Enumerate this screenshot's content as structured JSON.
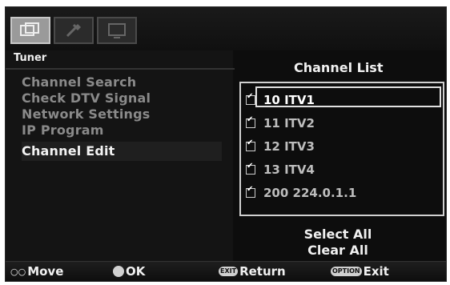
{
  "tabs": [
    {
      "icon": "channel-icon",
      "active": true
    },
    {
      "icon": "tools-icon",
      "active": false
    },
    {
      "icon": "screen-icon",
      "active": false
    }
  ],
  "section_label": "Tuner",
  "menu": {
    "items": [
      {
        "label": "Channel Search"
      },
      {
        "label": "Check DTV Signal"
      },
      {
        "label": "Network Settings"
      },
      {
        "label": "IP Program"
      },
      {
        "label": "Channel Edit"
      }
    ]
  },
  "channel_list": {
    "title": "Channel List",
    "items": [
      {
        "number_name": "10 ITV1",
        "checked": true,
        "selected": true
      },
      {
        "number_name": "11 ITV2",
        "checked": true,
        "selected": false
      },
      {
        "number_name": "12 ITV3",
        "checked": true,
        "selected": false
      },
      {
        "number_name": "13 ITV4",
        "checked": true,
        "selected": false
      },
      {
        "number_name": "200 224.0.1.1",
        "checked": true,
        "selected": false
      }
    ]
  },
  "actions": {
    "select_all": "Select All",
    "clear_all": "Clear All"
  },
  "bottom": {
    "move": "Move",
    "ok": "OK",
    "return_key": "EXIT",
    "return": "Return",
    "option_key": "OPTION",
    "exit": "Exit"
  }
}
